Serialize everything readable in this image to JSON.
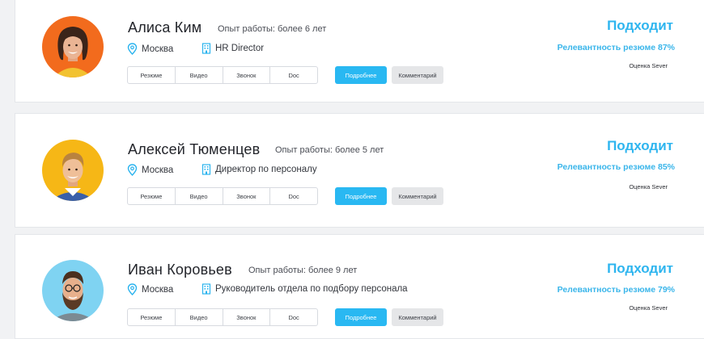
{
  "candidates": [
    {
      "name": "Алиса Ким",
      "experience": "Опыт работы: более 6 лет",
      "city": "Москва",
      "position": "HR Director",
      "tabs": [
        "Резюме",
        "Видео",
        "Звонок",
        "Doc"
      ],
      "more_label": "Подробнее",
      "comment_label": "Комментарий",
      "status": "Подходит",
      "relevance": "Релевантность резюме 87%",
      "rating": "Оценка Sever",
      "avatar_bg": "#f26b1d"
    },
    {
      "name": "Алексей Тюменцев",
      "experience": "Опыт работы: более 5 лет",
      "city": "Москва",
      "position": "Директор по персоналу",
      "tabs": [
        "Резюме",
        "Видео",
        "Звонок",
        "Doc"
      ],
      "more_label": "Подробнее",
      "comment_label": "Комментарий",
      "status": "Подходит",
      "relevance": "Релевантность резюме 85%",
      "rating": "Оценка Sever",
      "avatar_bg": "#f6b716"
    },
    {
      "name": "Иван Коровьев",
      "experience": "Опыт работы: более 9 лет",
      "city": "Москва",
      "position": "Руководитель отдела по подбору персонала",
      "tabs": [
        "Резюме",
        "Видео",
        "Звонок",
        "Doc"
      ],
      "more_label": "Подробнее",
      "comment_label": "Комментарий",
      "status": "Подходит",
      "relevance": "Релевантность резюме 79%",
      "rating": "Оценка Sever",
      "avatar_bg": "#7fd3f2"
    }
  ],
  "colors": {
    "accent": "#29b8f2",
    "status_text": "#2eb5ef",
    "comment_bg": "#e5e6e8"
  }
}
